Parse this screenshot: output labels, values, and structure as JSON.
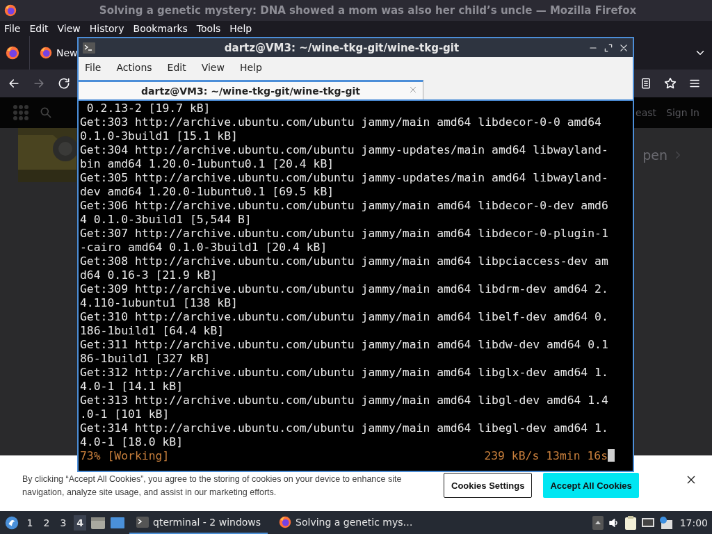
{
  "browser": {
    "title": "Solving a genetic mystery: DNA showed a mom was also her child’s uncle — Mozilla Firefox",
    "menu": [
      "File",
      "Edit",
      "View",
      "History",
      "Bookmarks",
      "Tools",
      "Help"
    ],
    "tab": {
      "label": "New"
    },
    "page": {
      "header_links": [
        "east",
        "Sign In"
      ],
      "banner_link": "pen"
    },
    "cookie_banner": {
      "text": "By clicking “Accept All Cookies”, you agree to the storing of cookies on your device to enhance site navigation, analyze site usage, and assist in our marketing efforts.",
      "buttons": [
        {
          "label": "Cookies Settings",
          "kind": "outline"
        },
        {
          "label": "Accept All Cookies",
          "kind": "primary"
        }
      ]
    }
  },
  "terminal": {
    "title": "dartz@VM3: ~/wine-tkg-git/wine-tkg-git",
    "menu": [
      "File",
      "Actions",
      "Edit",
      "View",
      "Help"
    ],
    "tabs": [
      {
        "label": "dartz@VM3: ~/wine-tkg-git/wine-tkg-git",
        "selected": true
      }
    ],
    "lines": [
      " 0.2.13-2 [19.7 kB]",
      "Get:303 http://archive.ubuntu.com/ubuntu jammy/main amd64 libdecor-0-0 amd64",
      "0.1.0-3build1 [15.1 kB]",
      "Get:304 http://archive.ubuntu.com/ubuntu jammy-updates/main amd64 libwayland-",
      "bin amd64 1.20.0-1ubuntu0.1 [20.4 kB]",
      "Get:305 http://archive.ubuntu.com/ubuntu jammy-updates/main amd64 libwayland-",
      "dev amd64 1.20.0-1ubuntu0.1 [69.5 kB]",
      "Get:306 http://archive.ubuntu.com/ubuntu jammy/main amd64 libdecor-0-dev amd6",
      "4 0.1.0-3build1 [5,544 B]",
      "Get:307 http://archive.ubuntu.com/ubuntu jammy/main amd64 libdecor-0-plugin-1",
      "-cairo amd64 0.1.0-3build1 [20.4 kB]",
      "Get:308 http://archive.ubuntu.com/ubuntu jammy/main amd64 libpciaccess-dev am",
      "d64 0.16-3 [21.9 kB]",
      "Get:309 http://archive.ubuntu.com/ubuntu jammy/main amd64 libdrm-dev amd64 2.",
      "4.110-1ubuntu1 [138 kB]",
      "Get:310 http://archive.ubuntu.com/ubuntu jammy/main amd64 libelf-dev amd64 0.",
      "186-1build1 [64.4 kB]",
      "Get:311 http://archive.ubuntu.com/ubuntu jammy/main amd64 libdw-dev amd64 0.1",
      "86-1build1 [327 kB]",
      "Get:312 http://archive.ubuntu.com/ubuntu jammy/main amd64 libglx-dev amd64 1.",
      "4.0-1 [14.1 kB]",
      "Get:313 http://archive.ubuntu.com/ubuntu jammy/main amd64 libgl-dev amd64 1.4",
      ".0-1 [101 kB]",
      "Get:314 http://archive.ubuntu.com/ubuntu jammy/main amd64 libegl-dev amd64 1.",
      "4.0-1 [18.0 kB]"
    ],
    "status": {
      "progress": "73% [Working]",
      "rate": "239 kB/s 13min 16s"
    }
  },
  "taskbar": {
    "workspaces": [
      {
        "label": "1",
        "selected": false
      },
      {
        "label": "2",
        "selected": false
      },
      {
        "label": "3",
        "selected": false
      },
      {
        "label": "4",
        "selected": true
      }
    ],
    "tasks": [
      {
        "label": "qterminal - 2 windows",
        "kind": "terminal",
        "selected": true
      },
      {
        "label": "Solving a genetic mys…",
        "kind": "firefox",
        "selected": false
      }
    ],
    "clock": "17:00"
  }
}
